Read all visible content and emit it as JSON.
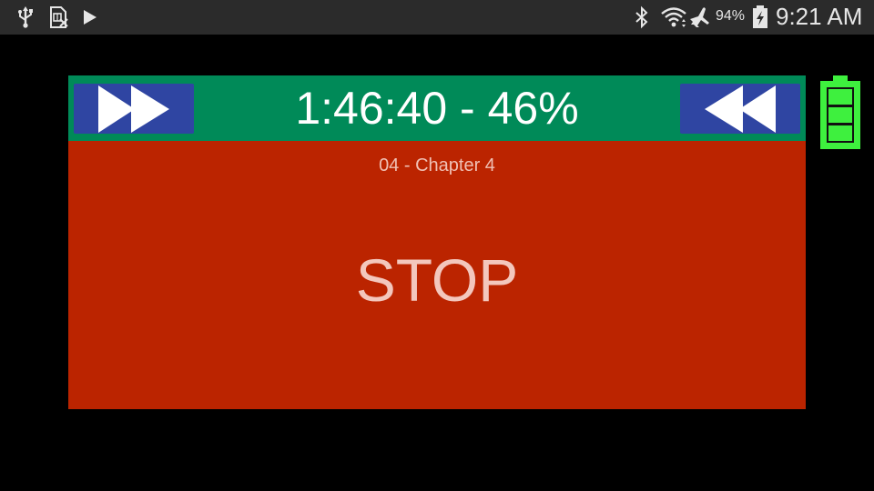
{
  "status_bar": {
    "icons_left": [
      "usb-icon",
      "sim-card-icon",
      "play-icon"
    ],
    "icons_right": [
      "bluetooth-icon",
      "wifi-icon",
      "airplane-icon",
      "battery-charging-icon"
    ],
    "battery_percent": "94%",
    "time": "9:21 AM"
  },
  "player": {
    "time_display": "1:46:40 - 46%",
    "chapter": "04 - Chapter 4",
    "stop_label": "STOP",
    "forward_icon": "fast-forward-icon",
    "rewind_icon": "rewind-icon",
    "battery_icon": "battery-full-icon",
    "battery_level": 1.0
  },
  "colors": {
    "top_bar": "#008a58",
    "panel": "#bb2400",
    "nav_button": "#2f45a2",
    "battery": "#3ef03e",
    "status_bar": "#2b2b2b"
  }
}
